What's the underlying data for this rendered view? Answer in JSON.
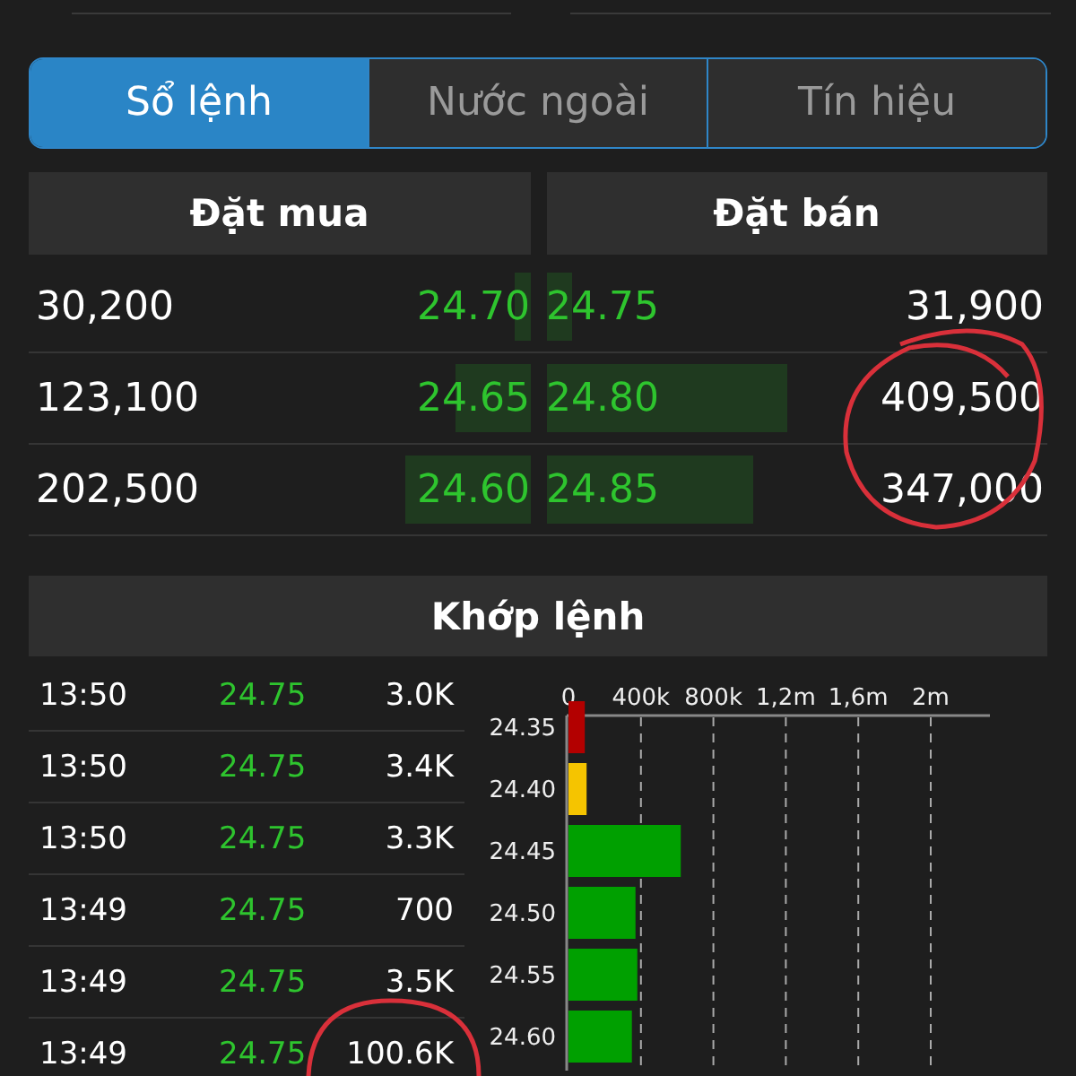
{
  "tabs": [
    {
      "label": "Sổ lệnh",
      "selected": true
    },
    {
      "label": "Nước ngoài",
      "selected": false
    },
    {
      "label": "Tín hiệu",
      "selected": false
    }
  ],
  "order_book": {
    "buy_header": "Đặt mua",
    "sell_header": "Đặt bán",
    "rows": [
      {
        "buy": {
          "volume": "30,200",
          "price": "24.70"
        },
        "sell": {
          "price": "24.75",
          "volume": "31,900"
        }
      },
      {
        "buy": {
          "volume": "123,100",
          "price": "24.65"
        },
        "sell": {
          "price": "24.80",
          "volume": "409,500"
        }
      },
      {
        "buy": {
          "volume": "202,500",
          "price": "24.60"
        },
        "sell": {
          "price": "24.85",
          "volume": "347,000"
        }
      }
    ]
  },
  "matches": {
    "title": "Khớp lệnh",
    "rows": [
      {
        "time": "13:50",
        "price": "24.75",
        "volume": "3.0K"
      },
      {
        "time": "13:50",
        "price": "24.75",
        "volume": "3.4K"
      },
      {
        "time": "13:50",
        "price": "24.75",
        "volume": "3.3K"
      },
      {
        "time": "13:49",
        "price": "24.75",
        "volume": "700"
      },
      {
        "time": "13:49",
        "price": "24.75",
        "volume": "3.5K"
      },
      {
        "time": "13:49",
        "price": "24.75",
        "volume": "100.6K"
      }
    ],
    "chart_data": {
      "type": "bar",
      "orientation": "horizontal",
      "categories": [
        "24.35",
        "24.40",
        "24.45",
        "24.50",
        "24.55",
        "24.60"
      ],
      "values": [
        90000,
        100000,
        620000,
        370000,
        380000,
        350000
      ],
      "grid": true,
      "colors": [
        "#b30000",
        "#f5c400",
        "#00a000",
        "#00a000",
        "#00a000",
        "#00a000"
      ],
      "xlim": [
        0,
        2000000
      ],
      "xticks": [
        {
          "value": 0,
          "label": "0"
        },
        {
          "value": 400000,
          "label": "400k"
        },
        {
          "value": 800000,
          "label": "800k"
        },
        {
          "value": 1200000,
          "label": "1,2m"
        },
        {
          "value": 1600000,
          "label": "1,6m"
        },
        {
          "value": 2000000,
          "label": "2m"
        }
      ]
    }
  }
}
